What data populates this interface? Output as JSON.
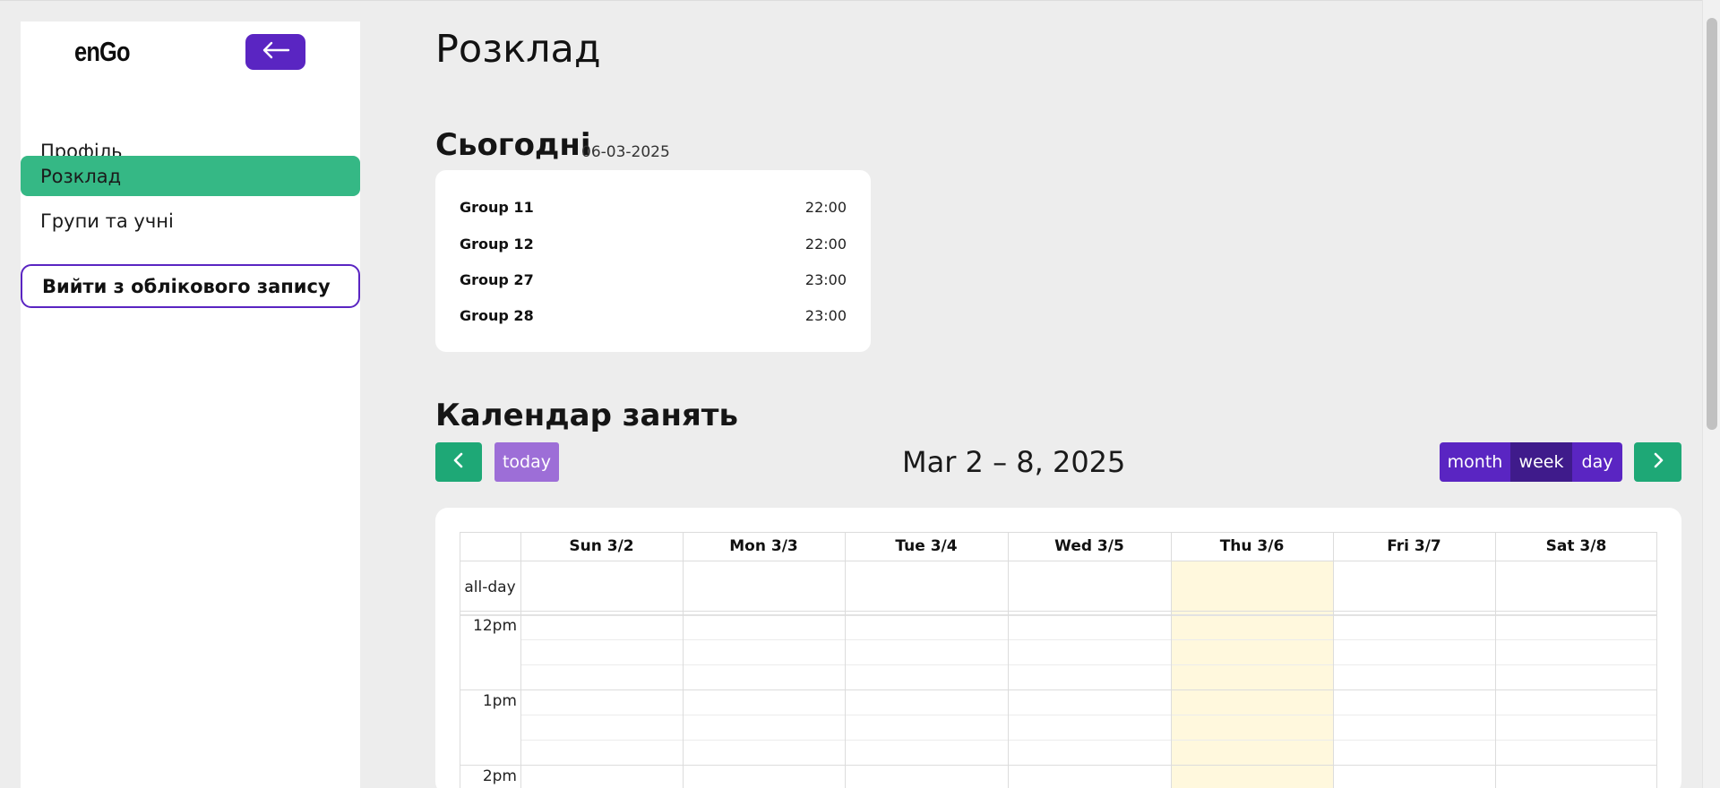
{
  "sidebar": {
    "logo": "enGo",
    "back_icon": "arrow-left-icon",
    "items": [
      {
        "label": "Профіль"
      },
      {
        "label": "Розклад",
        "active": true
      },
      {
        "label": "Групи та учні"
      }
    ],
    "logout_label": "Вийти з облікового запису"
  },
  "main": {
    "title": "Розклад",
    "today": {
      "heading": "Сьогодні",
      "date": "06-03-2025",
      "lessons": [
        {
          "name": "Group 11",
          "time": "22:00"
        },
        {
          "name": "Group 12",
          "time": "22:00"
        },
        {
          "name": "Group 27",
          "time": "23:00"
        },
        {
          "name": "Group 28",
          "time": "23:00"
        }
      ]
    },
    "calendar": {
      "heading": "Календар занять",
      "prev_icon": "chevron-left-icon",
      "next_icon": "chevron-right-icon",
      "today_label": "today",
      "range": "Mar 2 – 8, 2025",
      "views": [
        {
          "label": "month"
        },
        {
          "label": "week",
          "active": true
        },
        {
          "label": "day"
        }
      ],
      "days": [
        "Sun 3/2",
        "Mon 3/3",
        "Tue 3/4",
        "Wed 3/5",
        "Thu 3/6",
        "Fri 3/7",
        "Sat 3/8"
      ],
      "today_index": 4,
      "allday_label": "all-day",
      "times": [
        "12pm",
        "1pm",
        "2pm"
      ]
    }
  },
  "colors": {
    "accent": "#5a25c2",
    "green": "#35b885",
    "today_highlight": "#fff8dd"
  }
}
